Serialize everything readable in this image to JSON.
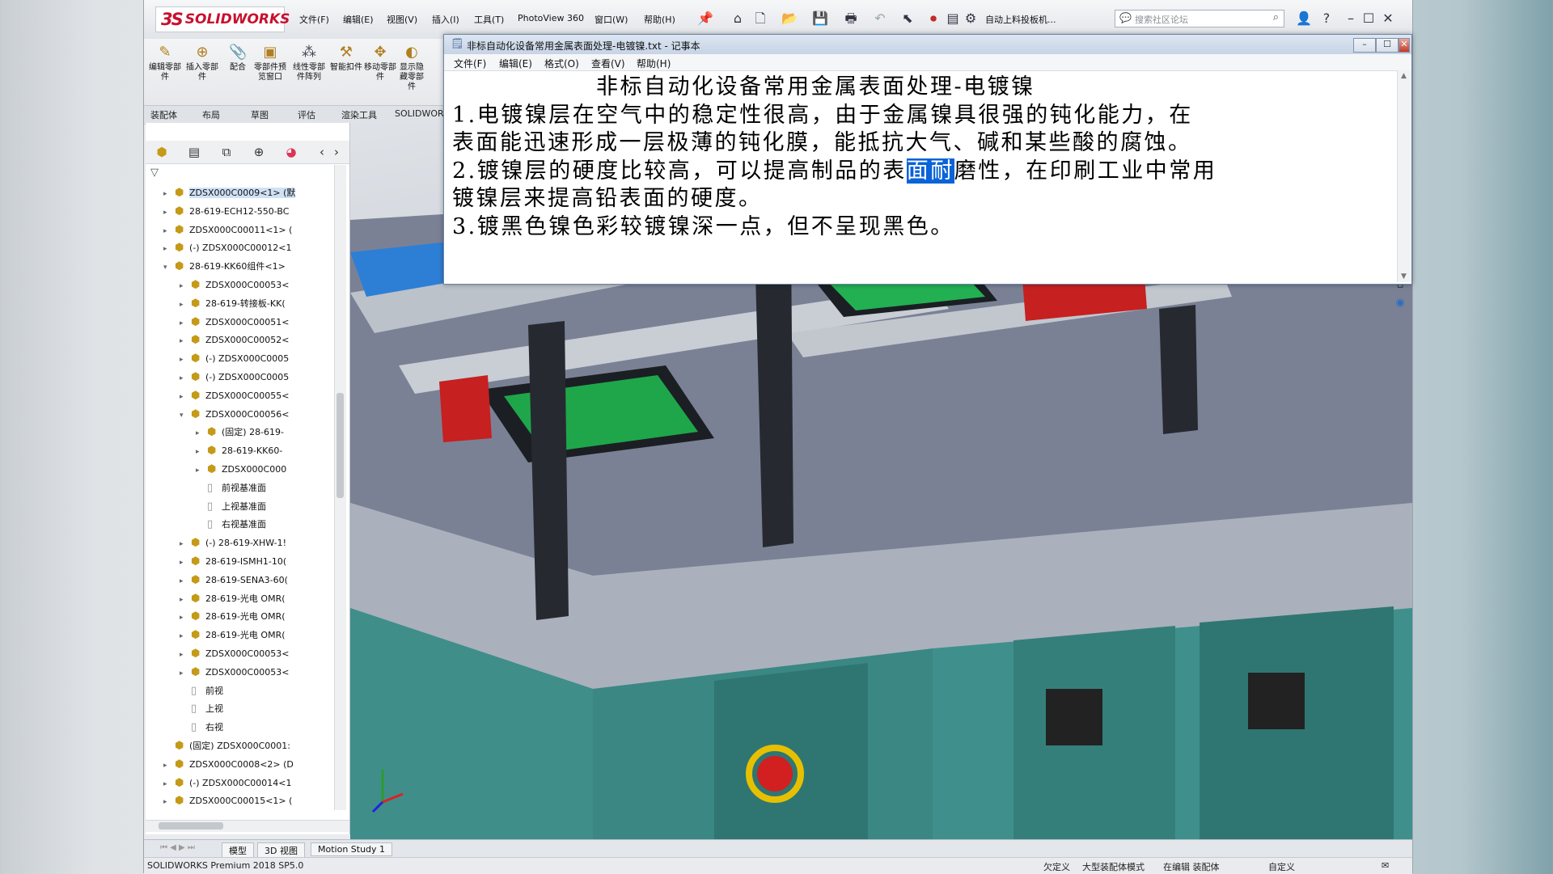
{
  "solidworks": {
    "logo": {
      "mark": "3S",
      "text": "SOLIDWORKS"
    },
    "menu": [
      "文件(F)",
      "编辑(E)",
      "视图(V)",
      "插入(I)",
      "工具(T)",
      "PhotoView 360",
      "窗口(W)",
      "帮助(H)"
    ],
    "doc_name": "自动上料投板机...",
    "search_placeholder": "搜索社区论坛",
    "ribbon_buttons": [
      "编辑零部件",
      "插入零部件",
      "配合",
      "零部件预览窗口",
      "线性零部件阵列",
      "智能扣件",
      "移动零部件",
      "显示隐藏零部件"
    ],
    "tabs": [
      "装配体",
      "布局",
      "草图",
      "评估",
      "渲染工具",
      "SOLIDWORKS"
    ],
    "tree": [
      {
        "indent": 0,
        "arrow": "▸",
        "icon": "assembly",
        "label": "ZDSX000C0009<1> (默",
        "selected": true
      },
      {
        "indent": 0,
        "arrow": "▸",
        "icon": "assembly",
        "label": "28-619-ECH12-550-BC"
      },
      {
        "indent": 0,
        "arrow": "▸",
        "icon": "assembly",
        "label": "ZDSX000C00011<1> ("
      },
      {
        "indent": 0,
        "arrow": "▸",
        "icon": "assembly",
        "label": "(-) ZDSX000C00012<1"
      },
      {
        "indent": 0,
        "arrow": "▾",
        "icon": "assembly",
        "label": "28-619-KK60组件<1>"
      },
      {
        "indent": 1,
        "arrow": "▸",
        "icon": "assembly",
        "label": "ZDSX000C00053<"
      },
      {
        "indent": 1,
        "arrow": "▸",
        "icon": "assembly",
        "label": "28-619-转接板-KK("
      },
      {
        "indent": 1,
        "arrow": "▸",
        "icon": "assembly",
        "label": "ZDSX000C00051<"
      },
      {
        "indent": 1,
        "arrow": "▸",
        "icon": "assembly",
        "label": "ZDSX000C00052<"
      },
      {
        "indent": 1,
        "arrow": "▸",
        "icon": "assembly",
        "label": "(-) ZDSX000C0005"
      },
      {
        "indent": 1,
        "arrow": "▸",
        "icon": "assembly",
        "label": "(-) ZDSX000C0005"
      },
      {
        "indent": 1,
        "arrow": "▸",
        "icon": "assembly",
        "label": "ZDSX000C00055<"
      },
      {
        "indent": 1,
        "arrow": "▾",
        "icon": "assembly",
        "label": "ZDSX000C00056<"
      },
      {
        "indent": 2,
        "arrow": "▸",
        "icon": "assembly",
        "label": "(固定) 28-619-"
      },
      {
        "indent": 2,
        "arrow": "▸",
        "icon": "assembly",
        "label": "28-619-KK60-"
      },
      {
        "indent": 2,
        "arrow": "▸",
        "icon": "assembly",
        "label": "ZDSX000C000"
      },
      {
        "indent": 2,
        "arrow": "",
        "icon": "plane",
        "label": "前视基准面"
      },
      {
        "indent": 2,
        "arrow": "",
        "icon": "plane",
        "label": "上视基准面"
      },
      {
        "indent": 2,
        "arrow": "",
        "icon": "plane",
        "label": "右视基准面"
      },
      {
        "indent": 1,
        "arrow": "▸",
        "icon": "assembly",
        "label": "(-) 28-619-XHW-1!"
      },
      {
        "indent": 1,
        "arrow": "▸",
        "icon": "assembly",
        "label": "28-619-ISMH1-10("
      },
      {
        "indent": 1,
        "arrow": "▸",
        "icon": "assembly",
        "label": "28-619-SENA3-60("
      },
      {
        "indent": 1,
        "arrow": "▸",
        "icon": "assembly",
        "label": "28-619-光电 OMR("
      },
      {
        "indent": 1,
        "arrow": "▸",
        "icon": "assembly",
        "label": "28-619-光电 OMR("
      },
      {
        "indent": 1,
        "arrow": "▸",
        "icon": "assembly",
        "label": "28-619-光电 OMR("
      },
      {
        "indent": 1,
        "arrow": "▸",
        "icon": "assembly",
        "label": "ZDSX000C00053<"
      },
      {
        "indent": 1,
        "arrow": "▸",
        "icon": "assembly",
        "label": "ZDSX000C00053<"
      },
      {
        "indent": 1,
        "arrow": "",
        "icon": "plane",
        "label": "前视"
      },
      {
        "indent": 1,
        "arrow": "",
        "icon": "plane",
        "label": "上视"
      },
      {
        "indent": 1,
        "arrow": "",
        "icon": "plane",
        "label": "右视"
      },
      {
        "indent": 0,
        "arrow": "",
        "icon": "assembly",
        "label": "(固定) ZDSX000C0001:"
      },
      {
        "indent": 0,
        "arrow": "▸",
        "icon": "assembly",
        "label": "ZDSX000C0008<2> (D"
      },
      {
        "indent": 0,
        "arrow": "▸",
        "icon": "assembly",
        "label": "(-) ZDSX000C00014<1"
      },
      {
        "indent": 0,
        "arrow": "▸",
        "icon": "assembly",
        "label": "ZDSX000C00015<1> ("
      }
    ],
    "bottom_tabs": [
      "模型",
      "3D 视图",
      "Motion Study 1"
    ],
    "status": {
      "version": "SOLIDWORKS Premium 2018 SP5.0",
      "define": "欠定义",
      "mode": "大型装配体模式",
      "editing": "在编辑 装配体",
      "custom": "自定义"
    }
  },
  "notepad": {
    "title": "非标自动化设备常用金属表面处理-电镀镍.txt - 记事本",
    "menu": [
      "文件(F)",
      "编辑(E)",
      "格式(O)",
      "查看(V)",
      "帮助(H)"
    ],
    "lines": {
      "heading": "非标自动化设备常用金属表面处理-电镀镍",
      "l1": " 1.电镀镍层在空气中的稳定性很高，由于金属镍具很强的钝化能力，在",
      "l2": "表面能迅速形成一层极薄的钝化膜，能抵抗大气、碱和某些酸的腐蚀。",
      "l3_pre": " 2.镀镍层的硬度比较高，可以提高制品的表",
      "l3_sel": "面耐",
      "l3_post": "磨性，在印刷工业中常用",
      "l4": "镀镍层来提高铅表面的硬度。",
      "l5": " 3.镀黑色镍色彩较镀镍深一点，但不呈现黑色。"
    },
    "selection_color": "#0a63d8"
  }
}
